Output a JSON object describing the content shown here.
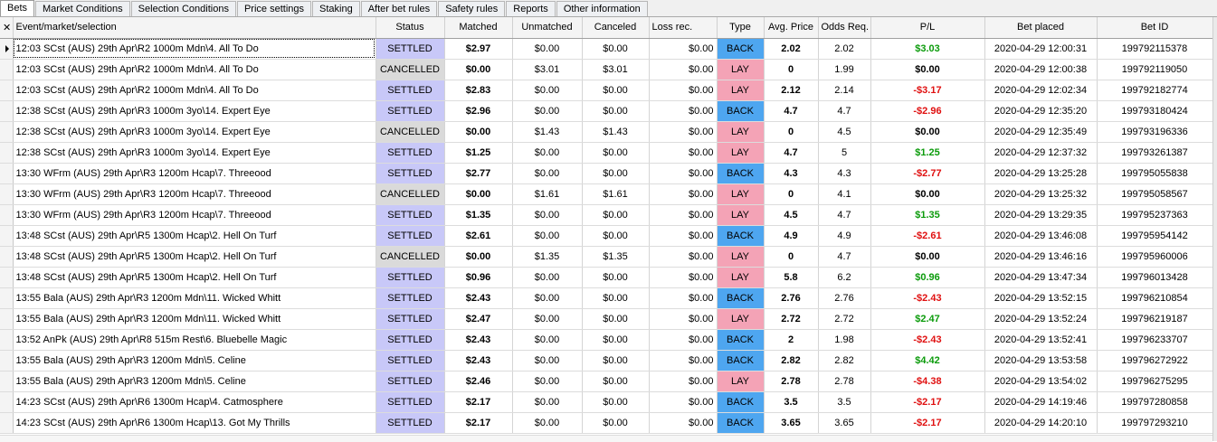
{
  "tabs": [
    "Bets",
    "Market Conditions",
    "Selection Conditions",
    "Price settings",
    "Staking",
    "After bet rules",
    "Safety rules",
    "Reports",
    "Other information"
  ],
  "active_tab": 0,
  "grid": {
    "close_glyph": "✕",
    "headers": [
      "Event/market/selection",
      "Status",
      "Matched",
      "Unmatched",
      "Canceled",
      "Loss rec.",
      "Type",
      "Avg. Price",
      "Odds Req.",
      "P/L",
      "Bet placed",
      "Bet ID"
    ],
    "rows": [
      {
        "event": "12:03 SCst (AUS) 29th Apr\\R2 1000m Mdn\\4. All To Do",
        "status": "SETTLED",
        "matched": "$2.97",
        "unmatched": "$0.00",
        "canceled": "$0.00",
        "lossrec": "$0.00",
        "type": "BACK",
        "avg": "2.02",
        "odds": "2.02",
        "pl": "$3.03",
        "placed": "2020-04-29 12:00:31",
        "id": "199792115378"
      },
      {
        "event": "12:03 SCst (AUS) 29th Apr\\R2 1000m Mdn\\4. All To Do",
        "status": "CANCELLED",
        "matched": "$0.00",
        "unmatched": "$3.01",
        "canceled": "$3.01",
        "lossrec": "$0.00",
        "type": "LAY",
        "avg": "0",
        "odds": "1.99",
        "pl": "$0.00",
        "placed": "2020-04-29 12:00:38",
        "id": "199792119050"
      },
      {
        "event": "12:03 SCst (AUS) 29th Apr\\R2 1000m Mdn\\4. All To Do",
        "status": "SETTLED",
        "matched": "$2.83",
        "unmatched": "$0.00",
        "canceled": "$0.00",
        "lossrec": "$0.00",
        "type": "LAY",
        "avg": "2.12",
        "odds": "2.14",
        "pl": "-$3.17",
        "placed": "2020-04-29 12:02:34",
        "id": "199792182774"
      },
      {
        "event": "12:38 SCst (AUS) 29th Apr\\R3 1000m 3yo\\14. Expert Eye",
        "status": "SETTLED",
        "matched": "$2.96",
        "unmatched": "$0.00",
        "canceled": "$0.00",
        "lossrec": "$0.00",
        "type": "BACK",
        "avg": "4.7",
        "odds": "4.7",
        "pl": "-$2.96",
        "placed": "2020-04-29 12:35:20",
        "id": "199793180424"
      },
      {
        "event": "12:38 SCst (AUS) 29th Apr\\R3 1000m 3yo\\14. Expert Eye",
        "status": "CANCELLED",
        "matched": "$0.00",
        "unmatched": "$1.43",
        "canceled": "$1.43",
        "lossrec": "$0.00",
        "type": "LAY",
        "avg": "0",
        "odds": "4.5",
        "pl": "$0.00",
        "placed": "2020-04-29 12:35:49",
        "id": "199793196336"
      },
      {
        "event": "12:38 SCst (AUS) 29th Apr\\R3 1000m 3yo\\14. Expert Eye",
        "status": "SETTLED",
        "matched": "$1.25",
        "unmatched": "$0.00",
        "canceled": "$0.00",
        "lossrec": "$0.00",
        "type": "LAY",
        "avg": "4.7",
        "odds": "5",
        "pl": "$1.25",
        "placed": "2020-04-29 12:37:32",
        "id": "199793261387"
      },
      {
        "event": "13:30 WFrm (AUS) 29th Apr\\R3 1200m Hcap\\7. Threeood",
        "status": "SETTLED",
        "matched": "$2.77",
        "unmatched": "$0.00",
        "canceled": "$0.00",
        "lossrec": "$0.00",
        "type": "BACK",
        "avg": "4.3",
        "odds": "4.3",
        "pl": "-$2.77",
        "placed": "2020-04-29 13:25:28",
        "id": "199795055838"
      },
      {
        "event": "13:30 WFrm (AUS) 29th Apr\\R3 1200m Hcap\\7. Threeood",
        "status": "CANCELLED",
        "matched": "$0.00",
        "unmatched": "$1.61",
        "canceled": "$1.61",
        "lossrec": "$0.00",
        "type": "LAY",
        "avg": "0",
        "odds": "4.1",
        "pl": "$0.00",
        "placed": "2020-04-29 13:25:32",
        "id": "199795058567"
      },
      {
        "event": "13:30 WFrm (AUS) 29th Apr\\R3 1200m Hcap\\7. Threeood",
        "status": "SETTLED",
        "matched": "$1.35",
        "unmatched": "$0.00",
        "canceled": "$0.00",
        "lossrec": "$0.00",
        "type": "LAY",
        "avg": "4.5",
        "odds": "4.7",
        "pl": "$1.35",
        "placed": "2020-04-29 13:29:35",
        "id": "199795237363"
      },
      {
        "event": "13:48 SCst (AUS) 29th Apr\\R5 1300m Hcap\\2. Hell On Turf",
        "status": "SETTLED",
        "matched": "$2.61",
        "unmatched": "$0.00",
        "canceled": "$0.00",
        "lossrec": "$0.00",
        "type": "BACK",
        "avg": "4.9",
        "odds": "4.9",
        "pl": "-$2.61",
        "placed": "2020-04-29 13:46:08",
        "id": "199795954142"
      },
      {
        "event": "13:48 SCst (AUS) 29th Apr\\R5 1300m Hcap\\2. Hell On Turf",
        "status": "CANCELLED",
        "matched": "$0.00",
        "unmatched": "$1.35",
        "canceled": "$1.35",
        "lossrec": "$0.00",
        "type": "LAY",
        "avg": "0",
        "odds": "4.7",
        "pl": "$0.00",
        "placed": "2020-04-29 13:46:16",
        "id": "199795960006"
      },
      {
        "event": "13:48 SCst (AUS) 29th Apr\\R5 1300m Hcap\\2. Hell On Turf",
        "status": "SETTLED",
        "matched": "$0.96",
        "unmatched": "$0.00",
        "canceled": "$0.00",
        "lossrec": "$0.00",
        "type": "LAY",
        "avg": "5.8",
        "odds": "6.2",
        "pl": "$0.96",
        "placed": "2020-04-29 13:47:34",
        "id": "199796013428"
      },
      {
        "event": "13:55 Bala (AUS) 29th Apr\\R3 1200m Mdn\\11. Wicked Whitt",
        "status": "SETTLED",
        "matched": "$2.43",
        "unmatched": "$0.00",
        "canceled": "$0.00",
        "lossrec": "$0.00",
        "type": "BACK",
        "avg": "2.76",
        "odds": "2.76",
        "pl": "-$2.43",
        "placed": "2020-04-29 13:52:15",
        "id": "199796210854"
      },
      {
        "event": "13:55 Bala (AUS) 29th Apr\\R3 1200m Mdn\\11. Wicked Whitt",
        "status": "SETTLED",
        "matched": "$2.47",
        "unmatched": "$0.00",
        "canceled": "$0.00",
        "lossrec": "$0.00",
        "type": "LAY",
        "avg": "2.72",
        "odds": "2.72",
        "pl": "$2.47",
        "placed": "2020-04-29 13:52:24",
        "id": "199796219187"
      },
      {
        "event": "13:52 AnPk (AUS) 29th Apr\\R8 515m Rest\\6. Bluebelle Magic",
        "status": "SETTLED",
        "matched": "$2.43",
        "unmatched": "$0.00",
        "canceled": "$0.00",
        "lossrec": "$0.00",
        "type": "BACK",
        "avg": "2",
        "odds": "1.98",
        "pl": "-$2.43",
        "placed": "2020-04-29 13:52:41",
        "id": "199796233707"
      },
      {
        "event": "13:55 Bala (AUS) 29th Apr\\R3 1200m Mdn\\5. Celine",
        "status": "SETTLED",
        "matched": "$2.43",
        "unmatched": "$0.00",
        "canceled": "$0.00",
        "lossrec": "$0.00",
        "type": "BACK",
        "avg": "2.82",
        "odds": "2.82",
        "pl": "$4.42",
        "placed": "2020-04-29 13:53:58",
        "id": "199796272922"
      },
      {
        "event": "13:55 Bala (AUS) 29th Apr\\R3 1200m Mdn\\5. Celine",
        "status": "SETTLED",
        "matched": "$2.46",
        "unmatched": "$0.00",
        "canceled": "$0.00",
        "lossrec": "$0.00",
        "type": "LAY",
        "avg": "2.78",
        "odds": "2.78",
        "pl": "-$4.38",
        "placed": "2020-04-29 13:54:02",
        "id": "199796275295"
      },
      {
        "event": "14:23 SCst (AUS) 29th Apr\\R6 1300m Hcap\\4. Catmosphere",
        "status": "SETTLED",
        "matched": "$2.17",
        "unmatched": "$0.00",
        "canceled": "$0.00",
        "lossrec": "$0.00",
        "type": "BACK",
        "avg": "3.5",
        "odds": "3.5",
        "pl": "-$2.17",
        "placed": "2020-04-29 14:19:46",
        "id": "199797280858"
      },
      {
        "event": "14:23 SCst (AUS) 29th Apr\\R6 1300m Hcap\\13. Got My Thrills",
        "status": "SETTLED",
        "matched": "$2.17",
        "unmatched": "$0.00",
        "canceled": "$0.00",
        "lossrec": "$0.00",
        "type": "BACK",
        "avg": "3.65",
        "odds": "3.65",
        "pl": "-$2.17",
        "placed": "2020-04-29 14:20:10",
        "id": "199797293210"
      }
    ]
  }
}
